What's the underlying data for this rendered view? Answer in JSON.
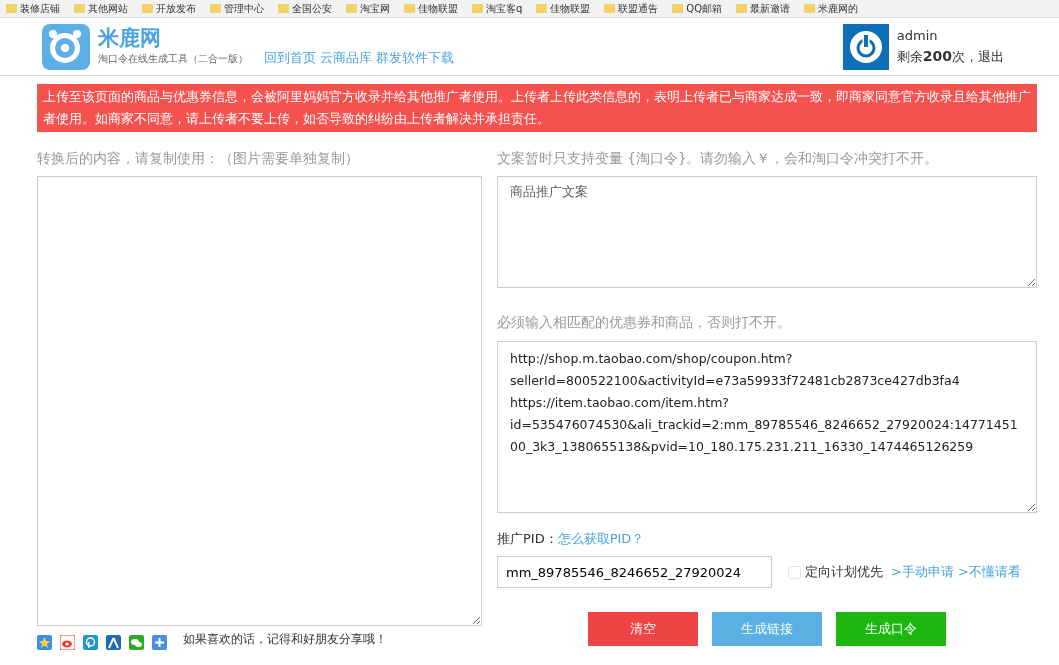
{
  "bookmarks": [
    {
      "label": "装修店铺"
    },
    {
      "label": "其他网站"
    },
    {
      "label": "开放发布"
    },
    {
      "label": "管理中心"
    },
    {
      "label": "全国公安"
    },
    {
      "label": "淘宝网"
    },
    {
      "label": "佳物联盟"
    },
    {
      "label": "淘宝客q"
    },
    {
      "label": "佳物联盟"
    },
    {
      "label": "联盟通告"
    },
    {
      "label": "QQ邮箱"
    },
    {
      "label": "最新邀请"
    },
    {
      "label": "米鹿网的"
    }
  ],
  "header": {
    "logo_text": "米鹿网",
    "subtitle": "淘口令在线生成工具（二合一版）",
    "nav_links": [
      "回到首页",
      "云商品库",
      "群发软件下载"
    ],
    "user": {
      "name": "admin",
      "quota_prefix": "剩余",
      "quota_count": "200",
      "quota_suffix": "次，",
      "logout": "退出"
    }
  },
  "notice": "上传至该页面的商品与优惠券信息，会被阿里妈妈官方收录并给其他推广者使用。上传者上传此类信息的，表明上传者已与商家达成一致，即商家同意官方收录且给其他推广者使用。如商家不同意，请上传者不要上传，如否导致的纠纷由上传者解决并承担责任。",
  "left": {
    "label": "转换后的内容，请复制使用：（图片需要单独复制）",
    "share_text": "如果喜欢的话，记得和好朋友分享哦！"
  },
  "right": {
    "copy_label": "文案暂时只支持变量 {淘口令}。请勿输入￥，会和淘口令冲突打不开。",
    "copy_placeholder": "商品推广文案",
    "links_label": "必须输入相匹配的优惠券和商品，否则打不开。",
    "links_value": "http://shop.m.taobao.com/shop/coupon.htm?sellerId=800522100&activityId=e73a59933f72481cb2873ce427db3fa4\nhttps://item.taobao.com/item.htm?id=535476074530&ali_trackid=2:mm_89785546_8246652_27920024:1477145100_3k3_1380655138&pvid=10_180.175.231.211_16330_1474465126259",
    "pid_label": "推广PID：",
    "pid_help": "怎么获取PID？",
    "pid_value": "mm_89785546_8246652_27920024",
    "priority": {
      "label": "定向计划优先",
      "checked": false
    },
    "extra_links": [
      ">手动申请",
      ">不懂请看"
    ],
    "buttons": [
      {
        "label": "清空",
        "kind": "danger"
      },
      {
        "label": "生成链接",
        "kind": "info"
      },
      {
        "label": "生成口令",
        "kind": "success"
      }
    ]
  }
}
